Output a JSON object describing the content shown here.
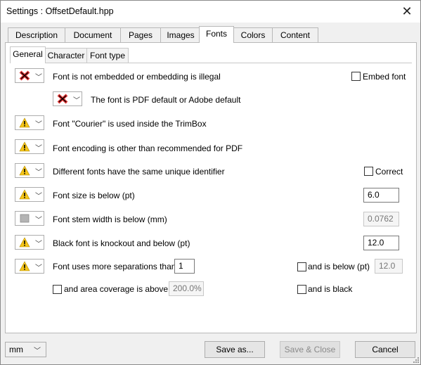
{
  "window": {
    "title": "Settings :  OffsetDefault.hpp"
  },
  "tabs": [
    "Description",
    "Document",
    "Pages",
    "Images",
    "Fonts",
    "Colors",
    "Content"
  ],
  "subtabs": [
    "General",
    "Character",
    "Font type"
  ],
  "rows": {
    "not_embedded": "Font is not embedded or embedding is illegal",
    "pdf_default": "The font is PDF default or Adobe default",
    "courier": "Font \"Courier\" is used inside the TrimBox",
    "encoding": "Font encoding is other than recommended for PDF",
    "unique_id": "Different fonts have the same unique identifier",
    "font_size": "Font size is below (pt)",
    "stem_width": "Font stem width is below (mm)",
    "black_knockout": "Black font is knockout and below (pt)",
    "separations": "Font uses more separations than"
  },
  "checkboxes": {
    "embed_font": "Embed font",
    "correct": "Correct",
    "and_below": "and is below (pt)",
    "area_coverage": "and area coverage is above",
    "is_black": "and is black"
  },
  "values": {
    "font_size": "6.0",
    "stem_width": "0.0762",
    "black_knockout": "12.0",
    "separations": "1",
    "and_below": "12.0",
    "area_coverage": "200.0%"
  },
  "footer": {
    "unit": "mm",
    "save_as": "Save as...",
    "save_close": "Save & Close",
    "cancel": "Cancel"
  }
}
